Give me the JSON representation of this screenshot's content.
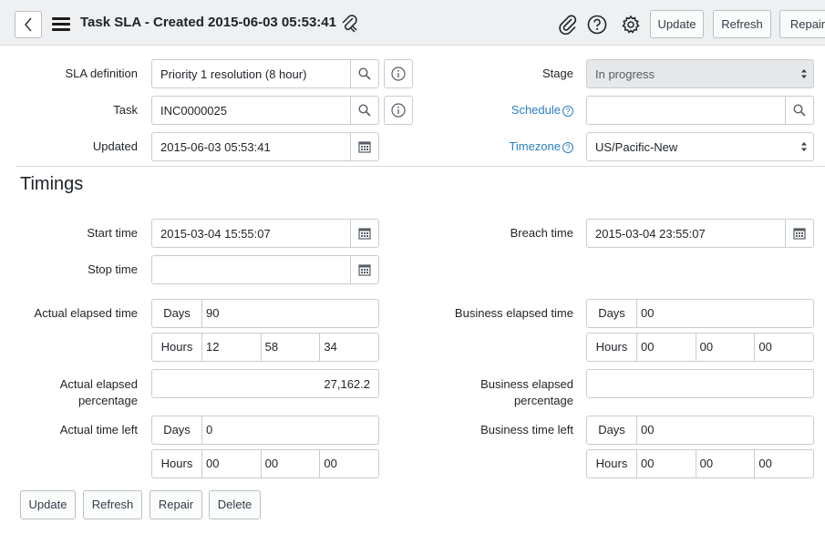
{
  "header": {
    "title": "Task SLA - Created 2015-06-03 05:53:41",
    "buttons": {
      "update": "Update",
      "refresh": "Refresh",
      "repair": "Repair"
    }
  },
  "form": {
    "sla_definition": {
      "label": "SLA definition",
      "value": "Priority 1 resolution (8 hour)"
    },
    "task": {
      "label": "Task",
      "value": "INC0000025"
    },
    "updated": {
      "label": "Updated",
      "value": "2015-06-03 05:53:41"
    },
    "stage": {
      "label": "Stage",
      "value": "In progress"
    },
    "schedule": {
      "label": "Schedule",
      "value": ""
    },
    "timezone": {
      "label": "Timezone",
      "value": "US/Pacific-New"
    },
    "help_glyph": "?"
  },
  "timings": {
    "section_title": "Timings",
    "start_time": {
      "label": "Start time",
      "value": "2015-03-04 15:55:07"
    },
    "stop_time": {
      "label": "Stop time",
      "value": ""
    },
    "breach_time": {
      "label": "Breach time",
      "value": "2015-03-04 23:55:07"
    },
    "actual_elapsed_time": {
      "label": "Actual elapsed time",
      "days_caption": "Days",
      "days": "90",
      "hours_caption": "Hours",
      "hours": "12",
      "minutes": "58",
      "seconds": "34"
    },
    "business_elapsed_time": {
      "label": "Business elapsed time",
      "days_caption": "Days",
      "days": "00",
      "hours_caption": "Hours",
      "hours": "00",
      "minutes": "00",
      "seconds": "00"
    },
    "actual_elapsed_percentage": {
      "label_line1": "Actual elapsed",
      "label_line2": "percentage",
      "value": "27,162.2"
    },
    "business_elapsed_percentage": {
      "label_line1": "Business elapsed",
      "label_line2": "percentage",
      "value": ""
    },
    "actual_time_left": {
      "label": "Actual time left",
      "days_caption": "Days",
      "days": "0",
      "hours_caption": "Hours",
      "hours": "00",
      "minutes": "00",
      "seconds": "00"
    },
    "business_time_left": {
      "label": "Business time left",
      "days_caption": "Days",
      "days": "00",
      "hours_caption": "Hours",
      "hours": "00",
      "minutes": "00",
      "seconds": "00"
    }
  },
  "footer": {
    "update": "Update",
    "refresh": "Refresh",
    "repair": "Repair",
    "delete": "Delete"
  },
  "icons": [
    "back-icon",
    "menu-icon",
    "attachment-icon",
    "paperclip-icon",
    "help-icon",
    "settings-icon",
    "search-icon",
    "info-icon",
    "calendar-icon",
    "select-caret-icon"
  ],
  "colors": {
    "header_bg": "#eef0f2",
    "link": "#2a7ec2",
    "readonly_bg": "#e6e8ea",
    "border": "#c9cdd1"
  }
}
